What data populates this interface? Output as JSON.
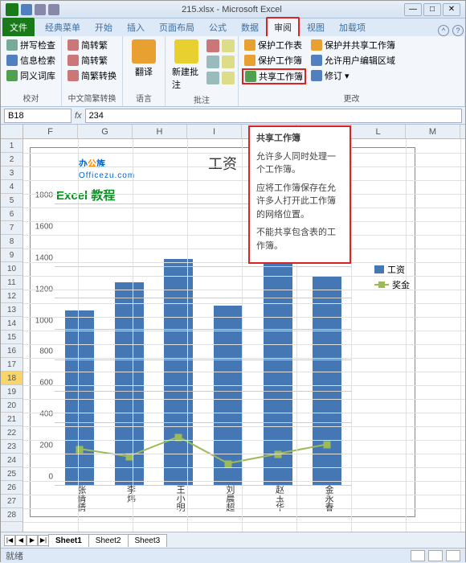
{
  "titlebar": {
    "title": "215.xlsx - Microsoft Excel"
  },
  "tabs": {
    "file": "文件",
    "items": [
      "经典菜单",
      "开始",
      "插入",
      "页面布局",
      "公式",
      "数据",
      "审阅",
      "视图",
      "加载项"
    ],
    "active_index": 6
  },
  "ribbon": {
    "proofing": {
      "label": "校对",
      "spell": "拼写检查",
      "info": "信息检索",
      "thesaurus": "同义词库"
    },
    "chinese": {
      "label": "中文简繁转换",
      "s2t": "简转繁",
      "t2s": "简转繁",
      "convert": "简繁转换"
    },
    "language": {
      "label": "语言",
      "translate": "翻译"
    },
    "comments": {
      "label": "批注",
      "new": "新建批注"
    },
    "changes": {
      "label": "更改",
      "protect_sheet": "保护工作表",
      "protect_share": "保护并共享工作簿",
      "protect_book": "保护工作簿",
      "allow_edit": "允许用户编辑区域",
      "share": "共享工作簿",
      "track": "修订"
    }
  },
  "namebox": {
    "cell": "B18",
    "formula": "234"
  },
  "columns": [
    "F",
    "G",
    "H",
    "I",
    "J",
    "K",
    "L",
    "M"
  ],
  "rows_count": 28,
  "selected_row": 18,
  "chart_data": {
    "type": "bar_line_combo",
    "title": "工资",
    "watermark": {
      "text": "办公族",
      "sub": "Officezu.com"
    },
    "subtitle": "Excel 教程",
    "categories": [
      "张倩倩",
      "李炜",
      "王小明",
      "刘晨超",
      "赵玉华",
      "金永春"
    ],
    "series": [
      {
        "name": "工资",
        "type": "bar",
        "color": "#4577b5",
        "values": [
          1120,
          1300,
          1450,
          1150,
          1600,
          1340
        ]
      },
      {
        "name": "奖金",
        "type": "line",
        "color": "#9bbb59",
        "values": [
          234,
          185,
          310,
          140,
          200,
          260
        ]
      }
    ],
    "ylim": [
      0,
      1800
    ],
    "ystep": 200
  },
  "tooltip": {
    "title": "共享工作簿",
    "p1": "允许多人同时处理一个工作簿。",
    "p2": "应将工作簿保存在允许多人打开此工作簿的网络位置。",
    "p3": "不能共享包含表的工作簿。"
  },
  "sheets": {
    "items": [
      "Sheet1",
      "Sheet2",
      "Sheet3"
    ],
    "active": 0
  },
  "status": {
    "ready": "就绪"
  }
}
